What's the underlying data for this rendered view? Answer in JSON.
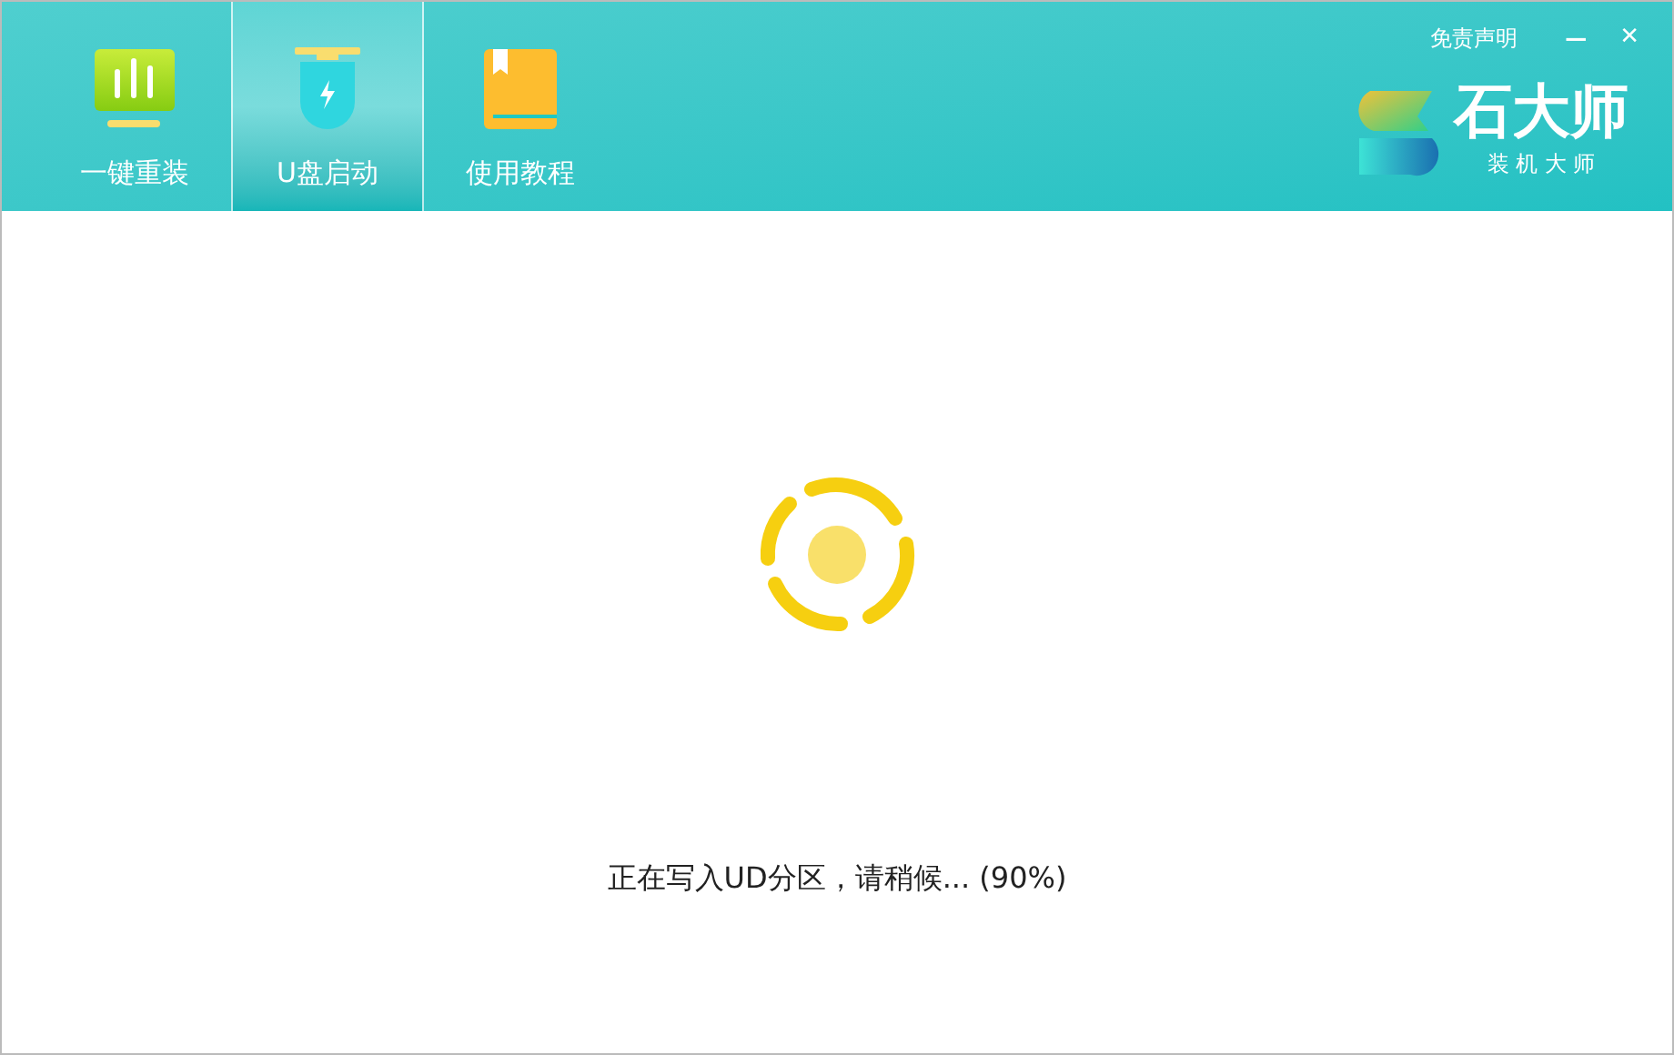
{
  "tabs": [
    {
      "label": "一键重装",
      "kind": "monitor",
      "selected": false
    },
    {
      "label": "U盘启动",
      "kind": "usb",
      "selected": true
    },
    {
      "label": "使用教程",
      "kind": "book",
      "selected": false
    }
  ],
  "header": {
    "disclaimer": "免责声明",
    "minimize": "—",
    "close": "✕"
  },
  "logo": {
    "name": "石大师",
    "tagline": "装 机 大 师"
  },
  "status": "正在写入UD分区，请稍候... (90%)"
}
